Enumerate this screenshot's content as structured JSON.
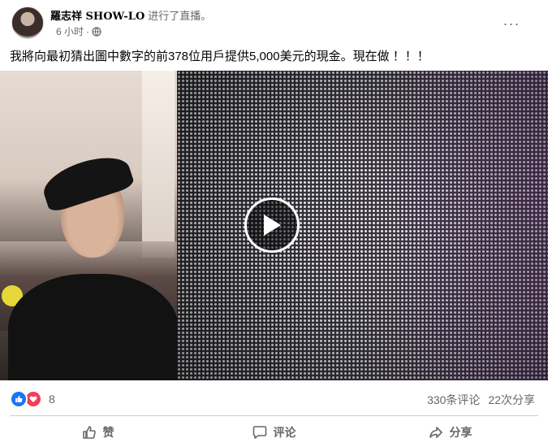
{
  "post": {
    "author": "羅志祥 SHOW-LO",
    "action": "进行了直播。",
    "time": "6 小时",
    "dot": "·",
    "text": "我將向最初猜出圖中數字的前378位用戶提供5,000美元的現金。現在做 ！！！"
  },
  "header": {
    "more_label": "···"
  },
  "video": {
    "play_icon": "play-icon"
  },
  "stats": {
    "reaction_count": "8",
    "comments": "330条评论",
    "shares": "22次分享"
  },
  "actions": {
    "like_label": "赞",
    "comment_label": "评论",
    "share_label": "分享"
  },
  "colors": {
    "like_blue": "#1877f2",
    "love_red": "#f33e58",
    "meta_gray": "#65676b"
  }
}
